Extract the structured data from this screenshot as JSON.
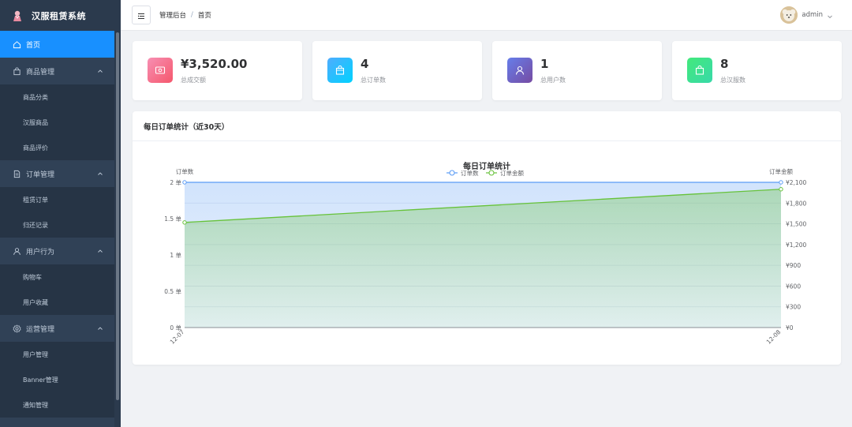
{
  "brand": {
    "title": "汉服租赁系统",
    "logo_icon": "hanfu-logo-icon"
  },
  "sidebar": {
    "items": [
      {
        "label": "首页",
        "icon": "home-icon",
        "active": true
      },
      {
        "label": "商品管理",
        "icon": "bag-icon",
        "children": [
          "商品分类",
          "汉服商品",
          "商品评价"
        ]
      },
      {
        "label": "订单管理",
        "icon": "document-icon",
        "children": [
          "租赁订单",
          "归还记录"
        ]
      },
      {
        "label": "用户行为",
        "icon": "user-icon",
        "children": [
          "购物车",
          "用户收藏"
        ]
      },
      {
        "label": "运营管理",
        "icon": "gear-icon",
        "children": [
          "用户管理",
          "Banner管理",
          "通知管理"
        ]
      }
    ]
  },
  "header": {
    "breadcrumb": [
      "管理后台",
      "首页"
    ],
    "user": {
      "name": "admin"
    }
  },
  "stats": [
    {
      "value": "¥3,520.00",
      "label": "总成交额",
      "icon": "money-icon",
      "color_from": "#f78fb3",
      "color_to": "#f5576c"
    },
    {
      "value": "4",
      "label": "总订单数",
      "icon": "shopping-bag-icon",
      "color_from": "#4facfe",
      "color_to": "#00d2ff"
    },
    {
      "value": "1",
      "label": "总用户数",
      "icon": "user-icon",
      "color_from": "#667eea",
      "color_to": "#764ba2"
    },
    {
      "value": "8",
      "label": "总汉服数",
      "icon": "bag-icon",
      "color_from": "#43e97b",
      "color_to": "#38d9a9"
    }
  ],
  "panel": {
    "title": "每日订单统计（近30天）"
  },
  "chart_data": {
    "type": "area",
    "title": "每日订单统计",
    "x": [
      "12-07",
      "12-08"
    ],
    "series": [
      {
        "name": "订单数",
        "axis": "left",
        "values": [
          2,
          2
        ],
        "color": "#5b9cf5"
      },
      {
        "name": "订单金额",
        "axis": "right",
        "values": [
          1520,
          2000
        ],
        "color": "#67c23a"
      }
    ],
    "left_axis": {
      "name": "订单数",
      "range": [
        0,
        2
      ],
      "ticks": [
        "0 单",
        "0.5 单",
        "1 单",
        "1.5 单",
        "2 单"
      ],
      "tick_values": [
        0,
        0.5,
        1,
        1.5,
        2
      ]
    },
    "right_axis": {
      "name": "订单金额",
      "range": [
        0,
        2100
      ],
      "ticks": [
        "¥0",
        "¥300",
        "¥600",
        "¥900",
        "¥1,200",
        "¥1,500",
        "¥1,800",
        "¥2,100"
      ],
      "tick_values": [
        0,
        300,
        600,
        900,
        1200,
        1500,
        1800,
        2100
      ]
    },
    "grid": true,
    "legend": "top-center"
  }
}
